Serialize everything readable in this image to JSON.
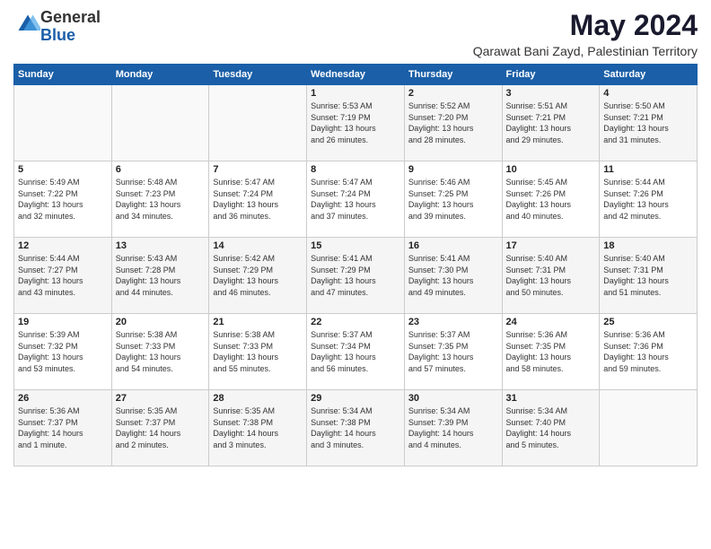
{
  "logo": {
    "text_general": "General",
    "text_blue": "Blue"
  },
  "title": "May 2024",
  "location": "Qarawat Bani Zayd, Palestinian Territory",
  "days_of_week": [
    "Sunday",
    "Monday",
    "Tuesday",
    "Wednesday",
    "Thursday",
    "Friday",
    "Saturday"
  ],
  "weeks": [
    [
      {
        "day": "",
        "content": ""
      },
      {
        "day": "",
        "content": ""
      },
      {
        "day": "",
        "content": ""
      },
      {
        "day": "1",
        "content": "Sunrise: 5:53 AM\nSunset: 7:19 PM\nDaylight: 13 hours\nand 26 minutes."
      },
      {
        "day": "2",
        "content": "Sunrise: 5:52 AM\nSunset: 7:20 PM\nDaylight: 13 hours\nand 28 minutes."
      },
      {
        "day": "3",
        "content": "Sunrise: 5:51 AM\nSunset: 7:21 PM\nDaylight: 13 hours\nand 29 minutes."
      },
      {
        "day": "4",
        "content": "Sunrise: 5:50 AM\nSunset: 7:21 PM\nDaylight: 13 hours\nand 31 minutes."
      }
    ],
    [
      {
        "day": "5",
        "content": "Sunrise: 5:49 AM\nSunset: 7:22 PM\nDaylight: 13 hours\nand 32 minutes."
      },
      {
        "day": "6",
        "content": "Sunrise: 5:48 AM\nSunset: 7:23 PM\nDaylight: 13 hours\nand 34 minutes."
      },
      {
        "day": "7",
        "content": "Sunrise: 5:47 AM\nSunset: 7:24 PM\nDaylight: 13 hours\nand 36 minutes."
      },
      {
        "day": "8",
        "content": "Sunrise: 5:47 AM\nSunset: 7:24 PM\nDaylight: 13 hours\nand 37 minutes."
      },
      {
        "day": "9",
        "content": "Sunrise: 5:46 AM\nSunset: 7:25 PM\nDaylight: 13 hours\nand 39 minutes."
      },
      {
        "day": "10",
        "content": "Sunrise: 5:45 AM\nSunset: 7:26 PM\nDaylight: 13 hours\nand 40 minutes."
      },
      {
        "day": "11",
        "content": "Sunrise: 5:44 AM\nSunset: 7:26 PM\nDaylight: 13 hours\nand 42 minutes."
      }
    ],
    [
      {
        "day": "12",
        "content": "Sunrise: 5:44 AM\nSunset: 7:27 PM\nDaylight: 13 hours\nand 43 minutes."
      },
      {
        "day": "13",
        "content": "Sunrise: 5:43 AM\nSunset: 7:28 PM\nDaylight: 13 hours\nand 44 minutes."
      },
      {
        "day": "14",
        "content": "Sunrise: 5:42 AM\nSunset: 7:29 PM\nDaylight: 13 hours\nand 46 minutes."
      },
      {
        "day": "15",
        "content": "Sunrise: 5:41 AM\nSunset: 7:29 PM\nDaylight: 13 hours\nand 47 minutes."
      },
      {
        "day": "16",
        "content": "Sunrise: 5:41 AM\nSunset: 7:30 PM\nDaylight: 13 hours\nand 49 minutes."
      },
      {
        "day": "17",
        "content": "Sunrise: 5:40 AM\nSunset: 7:31 PM\nDaylight: 13 hours\nand 50 minutes."
      },
      {
        "day": "18",
        "content": "Sunrise: 5:40 AM\nSunset: 7:31 PM\nDaylight: 13 hours\nand 51 minutes."
      }
    ],
    [
      {
        "day": "19",
        "content": "Sunrise: 5:39 AM\nSunset: 7:32 PM\nDaylight: 13 hours\nand 53 minutes."
      },
      {
        "day": "20",
        "content": "Sunrise: 5:38 AM\nSunset: 7:33 PM\nDaylight: 13 hours\nand 54 minutes."
      },
      {
        "day": "21",
        "content": "Sunrise: 5:38 AM\nSunset: 7:33 PM\nDaylight: 13 hours\nand 55 minutes."
      },
      {
        "day": "22",
        "content": "Sunrise: 5:37 AM\nSunset: 7:34 PM\nDaylight: 13 hours\nand 56 minutes."
      },
      {
        "day": "23",
        "content": "Sunrise: 5:37 AM\nSunset: 7:35 PM\nDaylight: 13 hours\nand 57 minutes."
      },
      {
        "day": "24",
        "content": "Sunrise: 5:36 AM\nSunset: 7:35 PM\nDaylight: 13 hours\nand 58 minutes."
      },
      {
        "day": "25",
        "content": "Sunrise: 5:36 AM\nSunset: 7:36 PM\nDaylight: 13 hours\nand 59 minutes."
      }
    ],
    [
      {
        "day": "26",
        "content": "Sunrise: 5:36 AM\nSunset: 7:37 PM\nDaylight: 14 hours\nand 1 minute."
      },
      {
        "day": "27",
        "content": "Sunrise: 5:35 AM\nSunset: 7:37 PM\nDaylight: 14 hours\nand 2 minutes."
      },
      {
        "day": "28",
        "content": "Sunrise: 5:35 AM\nSunset: 7:38 PM\nDaylight: 14 hours\nand 3 minutes."
      },
      {
        "day": "29",
        "content": "Sunrise: 5:34 AM\nSunset: 7:38 PM\nDaylight: 14 hours\nand 3 minutes."
      },
      {
        "day": "30",
        "content": "Sunrise: 5:34 AM\nSunset: 7:39 PM\nDaylight: 14 hours\nand 4 minutes."
      },
      {
        "day": "31",
        "content": "Sunrise: 5:34 AM\nSunset: 7:40 PM\nDaylight: 14 hours\nand 5 minutes."
      },
      {
        "day": "",
        "content": ""
      }
    ]
  ]
}
